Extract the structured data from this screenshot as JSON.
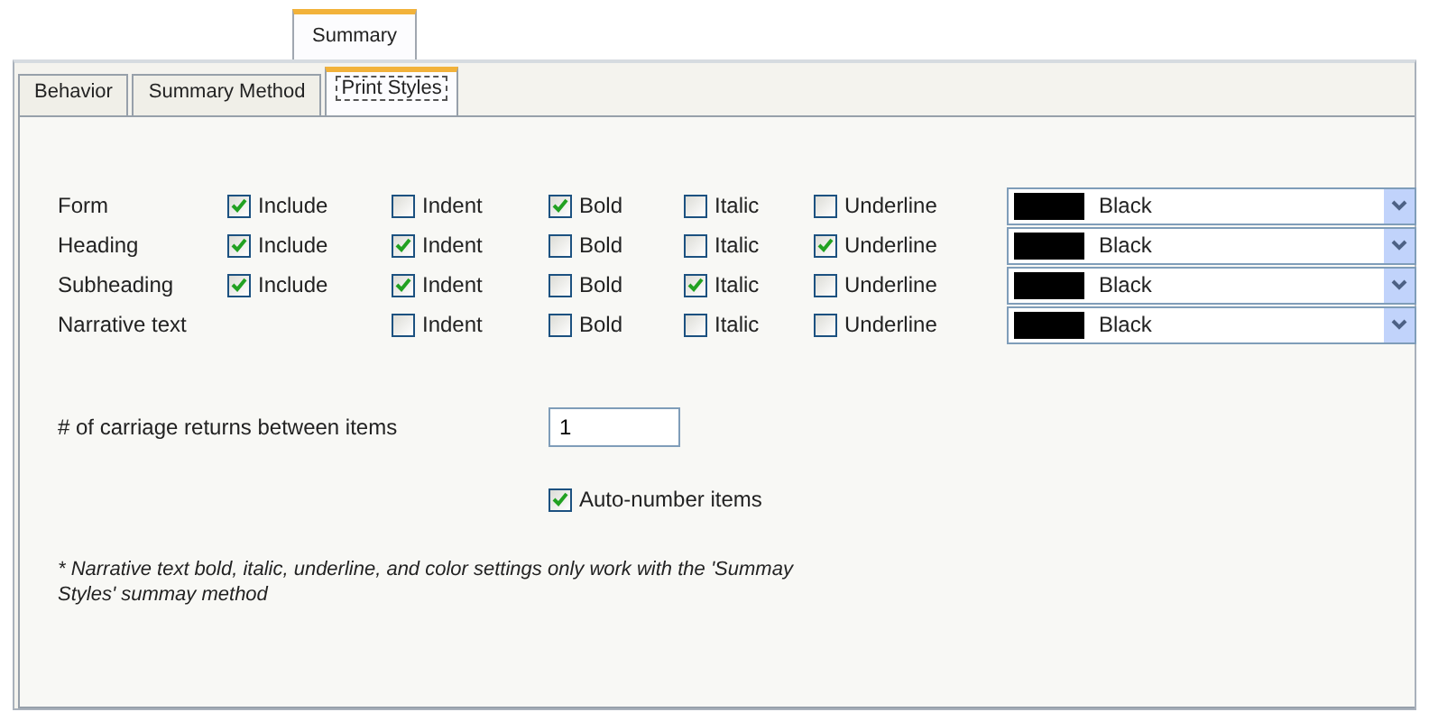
{
  "outer_tabs": [
    {
      "label": "Summary",
      "selected": true
    }
  ],
  "tabs": [
    {
      "label": "Behavior",
      "selected": false
    },
    {
      "label": "Summary Method",
      "selected": false
    },
    {
      "label": "Print Styles",
      "selected": true
    }
  ],
  "style_rows": [
    {
      "label": "Form",
      "options": [
        {
          "kind": "include",
          "label": "Include",
          "checked": true
        },
        {
          "kind": "indent",
          "label": "Indent",
          "checked": false
        },
        {
          "kind": "bold",
          "label": "Bold",
          "checked": true
        },
        {
          "kind": "italic",
          "label": "Italic",
          "checked": false
        },
        {
          "kind": "underline",
          "label": "Underline",
          "checked": false
        }
      ],
      "color_name": "Black",
      "color": "#000000"
    },
    {
      "label": "Heading",
      "options": [
        {
          "kind": "include",
          "label": "Include",
          "checked": true
        },
        {
          "kind": "indent",
          "label": "Indent",
          "checked": true
        },
        {
          "kind": "bold",
          "label": "Bold",
          "checked": false
        },
        {
          "kind": "italic",
          "label": "Italic",
          "checked": false
        },
        {
          "kind": "underline",
          "label": "Underline",
          "checked": true
        }
      ],
      "color_name": "Black",
      "color": "#000000"
    },
    {
      "label": "Subheading",
      "options": [
        {
          "kind": "include",
          "label": "Include",
          "checked": true
        },
        {
          "kind": "indent",
          "label": "Indent",
          "checked": true
        },
        {
          "kind": "bold",
          "label": "Bold",
          "checked": false
        },
        {
          "kind": "italic",
          "label": "Italic",
          "checked": true
        },
        {
          "kind": "underline",
          "label": "Underline",
          "checked": false
        }
      ],
      "color_name": "Black",
      "color": "#000000"
    },
    {
      "label": "Narrative text",
      "options": [
        {
          "kind": "indent",
          "label": "Indent",
          "checked": false
        },
        {
          "kind": "bold",
          "label": "Bold",
          "checked": false
        },
        {
          "kind": "italic",
          "label": "Italic",
          "checked": false
        },
        {
          "kind": "underline",
          "label": "Underline",
          "checked": false
        }
      ],
      "color_name": "Black",
      "color": "#000000"
    }
  ],
  "carriage_returns": {
    "label": "# of carriage returns between items",
    "value": "1"
  },
  "auto_number": {
    "label": "Auto-number items",
    "checked": true
  },
  "footnote": "* Narrative text bold, italic, underline, and color settings only work with the 'Summay Styles' summay method"
}
